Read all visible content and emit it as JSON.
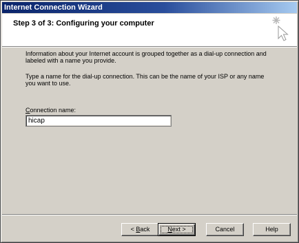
{
  "window": {
    "title": "Internet Connection Wizard"
  },
  "header": {
    "step_title": "Step 3 of 3: Configuring your computer",
    "icon": "wizard-cursor-icon"
  },
  "content": {
    "paragraph1": "Information about your Internet account is grouped together as a dial-up connection and labeled with a name you provide.",
    "paragraph2": "Type a name for the dial-up connection. This can be the name of your ISP or any name you want to use.",
    "connection_name_label_accesskey": "C",
    "connection_name_label_rest": "onnection name:",
    "connection_name_value": "hicap"
  },
  "buttons": {
    "back_prefix": "< ",
    "back_accesskey": "B",
    "back_rest": "ack",
    "next_accesskey": "N",
    "next_rest": "ext >",
    "cancel": "Cancel",
    "help": "Help"
  },
  "colors": {
    "titlebar_start": "#0a246a",
    "titlebar_end": "#a6caf0",
    "face": "#d4d0c8"
  }
}
